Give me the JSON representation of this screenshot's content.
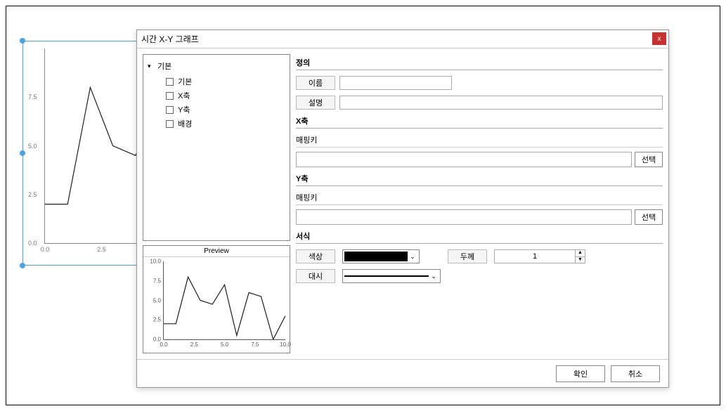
{
  "dialog": {
    "title": "시간 X-Y 그래프",
    "close_label": "x",
    "ok_label": "확인",
    "cancel_label": "취소"
  },
  "tree": {
    "root": "기본",
    "items": [
      {
        "label": "기본"
      },
      {
        "label": "X축"
      },
      {
        "label": "Y축"
      },
      {
        "label": "배경"
      }
    ]
  },
  "preview": {
    "title": "Preview"
  },
  "sections": {
    "definition": "정의",
    "name_label": "이름",
    "name_value": "",
    "desc_label": "설명",
    "desc_value": "",
    "x_axis": "X축",
    "y_axis": "Y축",
    "mapping_key": "매핑키",
    "select_btn": "선택",
    "style": "서식",
    "color_label": "색상",
    "thickness_label": "두께",
    "thickness_value": "1",
    "dash_label": "대시"
  },
  "chart_data": {
    "type": "line",
    "xlim": [
      0,
      10
    ],
    "ylim": [
      0,
      10
    ],
    "x_ticks": [
      0.0,
      2.5,
      5.0,
      7.5,
      10.0
    ],
    "y_ticks": [
      0.0,
      2.5,
      5.0,
      7.5,
      10.0
    ],
    "bg_x_ticks": [
      0.0,
      2.5
    ],
    "bg_y_ticks": [
      0.0,
      2.5,
      5.0,
      7.5
    ],
    "series": [
      {
        "name": "preview",
        "x": [
          0,
          1,
          2,
          3,
          4,
          5,
          6,
          7,
          8,
          9,
          10
        ],
        "y": [
          2.0,
          2.0,
          8.0,
          5.0,
          4.5,
          7.0,
          0.5,
          6.0,
          5.5,
          0.0,
          3.0
        ]
      }
    ]
  }
}
